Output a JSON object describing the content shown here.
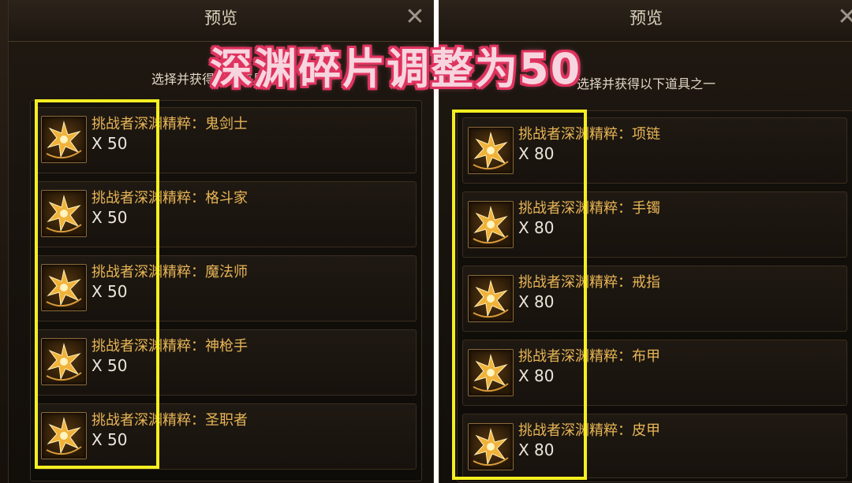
{
  "banner": "深渊碎片调整为50",
  "left_panel": {
    "title": "预览",
    "subtitle": "选择并获得以下道具之一",
    "items": [
      {
        "name": "挑战者深渊精粹：鬼剑士",
        "qty": "X 50"
      },
      {
        "name": "挑战者深渊精粹：格斗家",
        "qty": "X 50"
      },
      {
        "name": "挑战者深渊精粹：魔法师",
        "qty": "X 50"
      },
      {
        "name": "挑战者深渊精粹：神枪手",
        "qty": "X 50"
      },
      {
        "name": "挑战者深渊精粹：圣职者",
        "qty": "X 50"
      }
    ]
  },
  "right_panel": {
    "title": "预览",
    "subtitle": "选择并获得以下道具之一",
    "items": [
      {
        "name": "挑战者深渊精粹：项链",
        "qty": "X 80"
      },
      {
        "name": "挑战者深渊精粹：手镯",
        "qty": "X 80"
      },
      {
        "name": "挑战者深渊精粹：戒指",
        "qty": "X 80"
      },
      {
        "name": "挑战者深渊精粹：布甲",
        "qty": "X 80"
      },
      {
        "name": "挑战者深渊精粹：皮甲",
        "qty": "X 80"
      }
    ]
  },
  "icons": {
    "close": "close-icon",
    "item": "abyss-essence-icon"
  },
  "colors": {
    "highlight": "#f4ee21",
    "banner_fill": "#f7d5df",
    "banner_stroke": "#e0335f",
    "item_name": "#e8b556"
  }
}
